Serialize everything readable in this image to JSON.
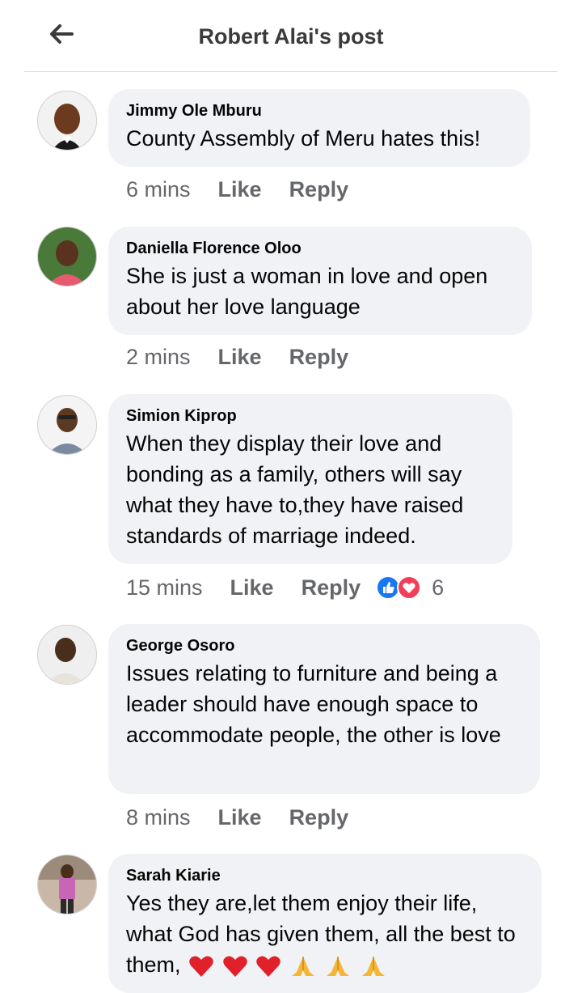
{
  "header": {
    "title": "Robert Alai's post",
    "back_icon": "arrow-left-icon"
  },
  "comments": [
    {
      "name": "Jimmy Ole Mburu",
      "text": "County Assembly of Meru hates this!",
      "time": "6 mins",
      "like": "Like",
      "reply": "Reply"
    },
    {
      "name": "Daniella Florence Oloo",
      "text": "She is just a woman in love and open about her love language",
      "time": "2 mins",
      "like": "Like",
      "reply": "Reply"
    },
    {
      "name": "Simion Kiprop",
      "text": "When they display their love and bonding as a family, others will say what they have to,they have raised standards of marriage indeed.",
      "time": "15 mins",
      "like": "Like",
      "reply": "Reply",
      "reactions": {
        "count": "6",
        "types": [
          "like",
          "love"
        ]
      }
    },
    {
      "name": "George Osoro",
      "text": "Issues relating to furniture and being a leader should have enough space to accommodate people, the other is love",
      "time": "8 mins",
      "like": "Like",
      "reply": "Reply"
    },
    {
      "name": "Sarah Kiarie",
      "text": "Yes  they are,let  them enjoy their life, what God has given them, all  the best to them,",
      "emojis": [
        "red-heart",
        "red-heart",
        "red-heart",
        "folded-hands",
        "folded-hands",
        "folded-hands"
      ]
    }
  ],
  "colors": {
    "bubble": "#f0f2f5",
    "meta": "#65676b",
    "like_blue": "#1877f2",
    "love_red": "#f33e58"
  }
}
